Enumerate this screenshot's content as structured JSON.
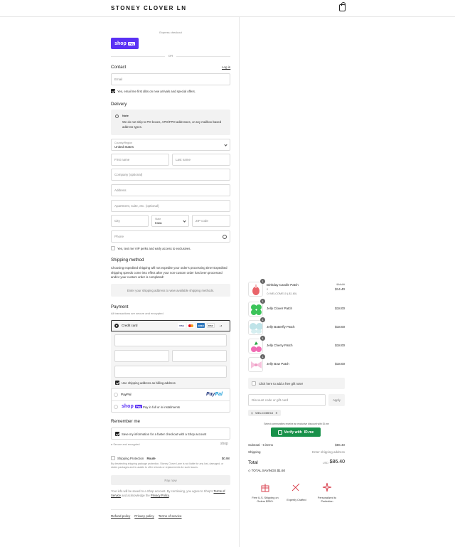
{
  "header": {
    "brand": "STONEY CLOVER LN",
    "cart_icon": "shopping-bag-icon"
  },
  "express": {
    "label": "Express checkout",
    "shop_pay_label": "shop",
    "shop_pay_badge": "Pay",
    "or": "OR"
  },
  "contact": {
    "title": "Contact",
    "login": "Log in",
    "email_placeholder": "Email",
    "newsletter_checked": true,
    "newsletter_label": "Yes, email me first dibs on new arrivals and special offers."
  },
  "delivery": {
    "title": "Delivery",
    "note_title": "Note",
    "note_text": "We do not ship to PO boxes, APO/FPO addresses, or any mailbox-based address types.",
    "country_label": "Country/Region",
    "country_value": "United States",
    "first_name": "First name",
    "last_name": "Last name",
    "company": "Company (optional)",
    "address": "Address",
    "apartment": "Apartment, suite, etc. (optional)",
    "city": "City",
    "state_label": "State",
    "state_value": "Iowa",
    "zip": "ZIP code",
    "phone": "Phone",
    "sms_label": "Yes, text me VIP perks and early access to exclusives."
  },
  "shipping": {
    "title": "Shipping method",
    "text": "Choosing expedited shipping will not expedite your order's processing time! Expedited shipping speeds come into effect after your non-custom order has been processed and/or your custom order is completed!",
    "placeholder": "Enter your shipping address to view available shipping methods."
  },
  "payment": {
    "title": "Payment",
    "subtitle": "All transactions are secure and encrypted.",
    "credit_card": "Credit card",
    "card_brands": [
      "VISA",
      "MC",
      "AMEX",
      "DISC",
      "+4"
    ],
    "use_shipping": "Use shipping address as billing address",
    "paypal_label": "PayPal",
    "paypal_logo_a": "Pay",
    "paypal_logo_b": "Pal",
    "shoppay_logo": "shop",
    "shoppay_badge": "Pay",
    "shoppay_text": "Pay in full or in installments"
  },
  "remember": {
    "title": "Remember me",
    "save_label": "Save my information for a faster checkout with a Shop account",
    "secure": "Secure and encrypted",
    "shop": "shop"
  },
  "protection": {
    "label": "Shipping Protection",
    "brand": "Route",
    "price": "$0.98",
    "text": "By deselecting shipping package protection, Stoney Clover Lane is not liable for any lost, damaged, or stolen packages and is unable to offer refunds or replacements for such issues."
  },
  "pay_now": "Pay now",
  "consent": {
    "text_a": "Your info will be saved to a Shop account. By continuing, you agree to Shop's",
    "terms": "Terms of Service",
    "text_b": "and acknowledge the",
    "privacy": "Privacy Policy",
    "end": "."
  },
  "footer": {
    "refund": "Refund policy",
    "privacy": "Privacy policy",
    "terms": "Terms of service"
  },
  "order": {
    "items": [
      {
        "name": "Birthday Candle Patch",
        "qty": "1",
        "variant": "0",
        "discount": "WELCOME10 (-$1.60)",
        "old_price": "$16.00",
        "price": "$14.40",
        "icon": "candle-patch"
      },
      {
        "name": "Jelly Clover Patch",
        "qty": "1",
        "price": "$18.00",
        "icon": "clover-patch"
      },
      {
        "name": "Jelly Butterfly Patch",
        "qty": "1",
        "price": "$18.00",
        "icon": "butterfly-patch"
      },
      {
        "name": "Jelly Cherry Patch",
        "qty": "1",
        "price": "$18.00",
        "icon": "cherry-patch"
      },
      {
        "name": "Jelly Bow Patch",
        "qty": "1",
        "price": "$18.00",
        "icon": "bow-patch"
      }
    ],
    "gift_note": "Click here to add a free gift note!",
    "discount_placeholder": "Discount code or gift card",
    "apply": "Apply",
    "code_tag": "WELCOME10",
    "verify_hint": "Select communities receive an exclusive discount with ID.me",
    "verify_label": "Verify with",
    "verify_brand": "ID.me",
    "subtotal_label": "Subtotal · 5 items",
    "subtotal": "$86.40",
    "shipping_label": "Shipping",
    "shipping_value": "Enter shipping address",
    "total_label": "Total",
    "currency": "USD",
    "total": "$86.40",
    "savings": "TOTAL SAVINGS $1.60",
    "perks": [
      "Free U.S. Shipping on Orders $250+",
      "Expertly Crafted",
      "Personalized to Perfection"
    ]
  },
  "colors": {
    "shop_purple": "#5a31f4",
    "verify_green": "#18914a",
    "perk_red": "#d9414f"
  }
}
